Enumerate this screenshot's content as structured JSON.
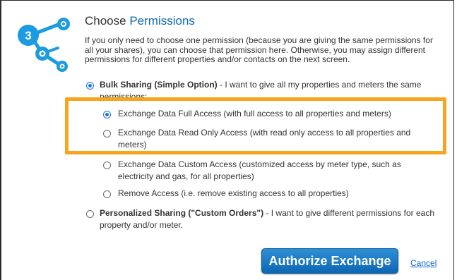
{
  "header": {
    "title_prefix": "Choose",
    "title_accent": "Permissions",
    "step_number": "3",
    "description": "If you only need to choose one permission (because you are giving the same permissions for all your shares), you can choose that permission here. Otherwise, you may assign different permissions for different properties and/or contacts on the next screen."
  },
  "bulk": {
    "label": "Bulk Sharing (Simple Option)",
    "text": " - I want to give all my properties and meters the same permissions:",
    "selected": true
  },
  "suboptions": [
    {
      "label": "Exchange Data Full Access (with full access to all properties and meters)",
      "selected": true
    },
    {
      "label": "Exchange Data Read Only Access (with read only access to all properties and meters)",
      "selected": false
    },
    {
      "label": "Exchange Data Custom Access (customized access by meter type, such as electricity and gas, for all properties)",
      "selected": false
    },
    {
      "label": "Remove Access (i.e. remove existing access to all properties)",
      "selected": false
    }
  ],
  "personalized": {
    "label": "Personalized Sharing (\"Custom Orders\")",
    "text": " - I want to give different permissions for each property and/or meter.",
    "selected": false
  },
  "actions": {
    "authorize_label": "Authorize Exchange",
    "cancel_label": "Cancel"
  },
  "colors": {
    "accent": "#0b66b1",
    "highlight": "#f7a51c",
    "button": "#0d67b4"
  }
}
